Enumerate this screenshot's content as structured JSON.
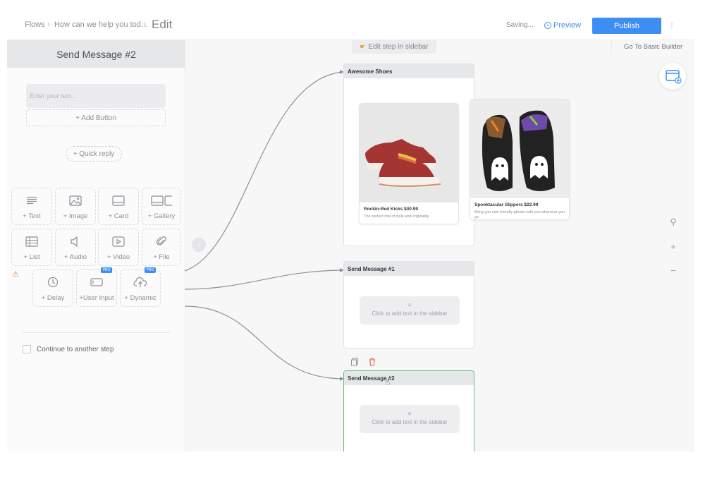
{
  "header": {
    "breadcrumb": [
      "Flows",
      "How can we help you tod..."
    ],
    "edit_label": "Edit",
    "saving_text": "Saving...",
    "preview_label": "Preview",
    "publish_label": "Publish",
    "more_label": "⋮"
  },
  "sidebar": {
    "title": "Send Message #2",
    "text_placeholder": "Enter your text...",
    "add_button_label": "+ Add Button",
    "quick_reply_label": "+ Quick reply",
    "tiles": [
      {
        "label": "+ Text",
        "icon": "text-icon"
      },
      {
        "label": "+ Image",
        "icon": "image-icon"
      },
      {
        "label": "+ Card",
        "icon": "card-icon"
      },
      {
        "label": "+ Gallery",
        "icon": "gallery-icon"
      },
      {
        "label": "+ List",
        "icon": "list-icon"
      },
      {
        "label": "+ Audio",
        "icon": "audio-icon"
      },
      {
        "label": "+ Video",
        "icon": "video-icon"
      },
      {
        "label": "+ File",
        "icon": "paperclip-icon"
      },
      {
        "label": "+ Delay",
        "icon": "clock-icon"
      },
      {
        "label": "+User Input",
        "icon": "user-input-icon",
        "badge": "PRO"
      },
      {
        "label": "+ Dynamic",
        "icon": "cloud-upload-icon",
        "badge": "PRO"
      }
    ],
    "continue_label": "Continue to another step"
  },
  "canvas": {
    "edit_hint": "Edit step in sidebar",
    "basic_builder_label": "Go To Basic Builder",
    "nodes": [
      {
        "title": "Awesome Shoes"
      },
      {
        "title": "Send Message #1",
        "body": "Click to add text in the sidebar"
      },
      {
        "title": "Send Message #2",
        "body": "Click to add text in the sidebar"
      }
    ],
    "cards": [
      {
        "title": "Rockin-Red Kicks $40.99",
        "subtitle": "The perfect mix of style and originality"
      },
      {
        "title": "Spooktacular Slippers $22.99",
        "subtitle": "Bring you own friendly ghosts with you wherever you go"
      }
    ]
  },
  "colors": {
    "accent": "#3d8ef2",
    "selected_node_border": "#5cc47a",
    "warning": "#e07a3f",
    "delete": "#e8664a"
  }
}
